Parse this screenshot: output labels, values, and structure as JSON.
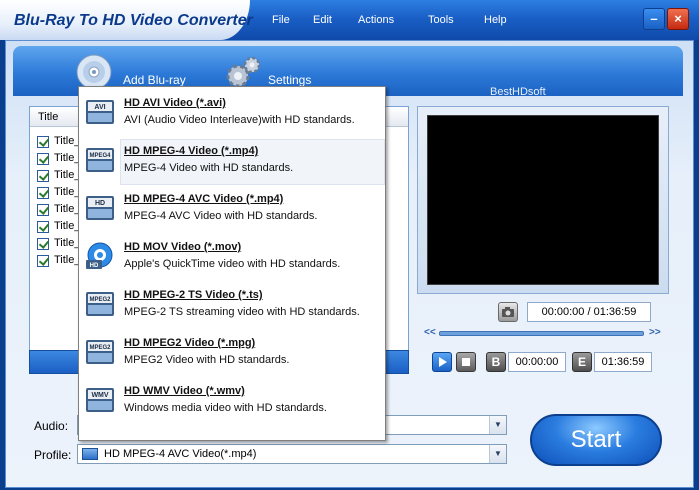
{
  "app": {
    "title": "Blu-Ray To HD Video Converter",
    "brand": "BestHDsoft"
  },
  "menu": {
    "items": [
      "File",
      "Edit",
      "Actions",
      "Tools",
      "Help"
    ]
  },
  "window_controls": {
    "minimize": "–",
    "close": "×"
  },
  "toolbar": {
    "add_bluray_label": "Add Blu-ray",
    "settings_label": "Settings"
  },
  "file_list": {
    "header_title": "Title",
    "rows": [
      "Title_",
      "Title_",
      "Title_",
      "Title_",
      "Title_",
      "Title_",
      "Title_",
      "Title_"
    ]
  },
  "preview": {
    "current_time": "00:00:00",
    "total_time": "01:36:59",
    "begin_time": "00:00:00",
    "end_time": "01:36:59",
    "seek_back": "<<",
    "seek_forward": ">>",
    "begin_label": "B",
    "end_label": "E",
    "time_separator": "/"
  },
  "bottom": {
    "audio_label": "Audio:",
    "audio_value": "",
    "profile_label": "Profile:",
    "profile_value": "HD MPEG-4 AVC Video(*.mp4)",
    "start_label": "Start"
  },
  "profile_menu": {
    "selected_index": 1,
    "items": [
      {
        "name": "HD AVI Video (*.avi)",
        "desc": "AVI (Audio Video Interleave)with HD standards.",
        "icon": "avi-icon",
        "badge": "AVI"
      },
      {
        "name": "HD MPEG-4 Video (*.mp4)",
        "desc": "MPEG-4 Video with HD standards.",
        "icon": "mpeg4-icon",
        "badge": "MPEG4"
      },
      {
        "name": "HD MPEG-4 AVC Video (*.mp4)",
        "desc": "MPEG-4 AVC Video with HD standards.",
        "icon": "mpeg4-avc-icon",
        "badge": "HD"
      },
      {
        "name": "HD MOV Video (*.mov)",
        "desc": "Apple's QuickTime video with HD standards.",
        "icon": "quicktime-icon",
        "badge": "HD"
      },
      {
        "name": "HD MPEG-2 TS Video (*.ts)",
        "desc": "MPEG-2 TS streaming video with HD standards.",
        "icon": "mpeg2-ts-icon",
        "badge": "MPEG2"
      },
      {
        "name": "HD MPEG2 Video (*.mpg)",
        "desc": "MPEG2 Video with HD standards.",
        "icon": "mpeg2-icon",
        "badge": "MPEG2"
      },
      {
        "name": "HD WMV Video (*.wmv)",
        "desc": "Windows media video with HD standards.",
        "icon": "wmv-icon",
        "badge": "WMV"
      }
    ]
  },
  "colors": {
    "titlebar": "#1a5fc6",
    "frame": "#e6effa",
    "accent": "#2b7de0",
    "start_button": "#2b7de0"
  }
}
